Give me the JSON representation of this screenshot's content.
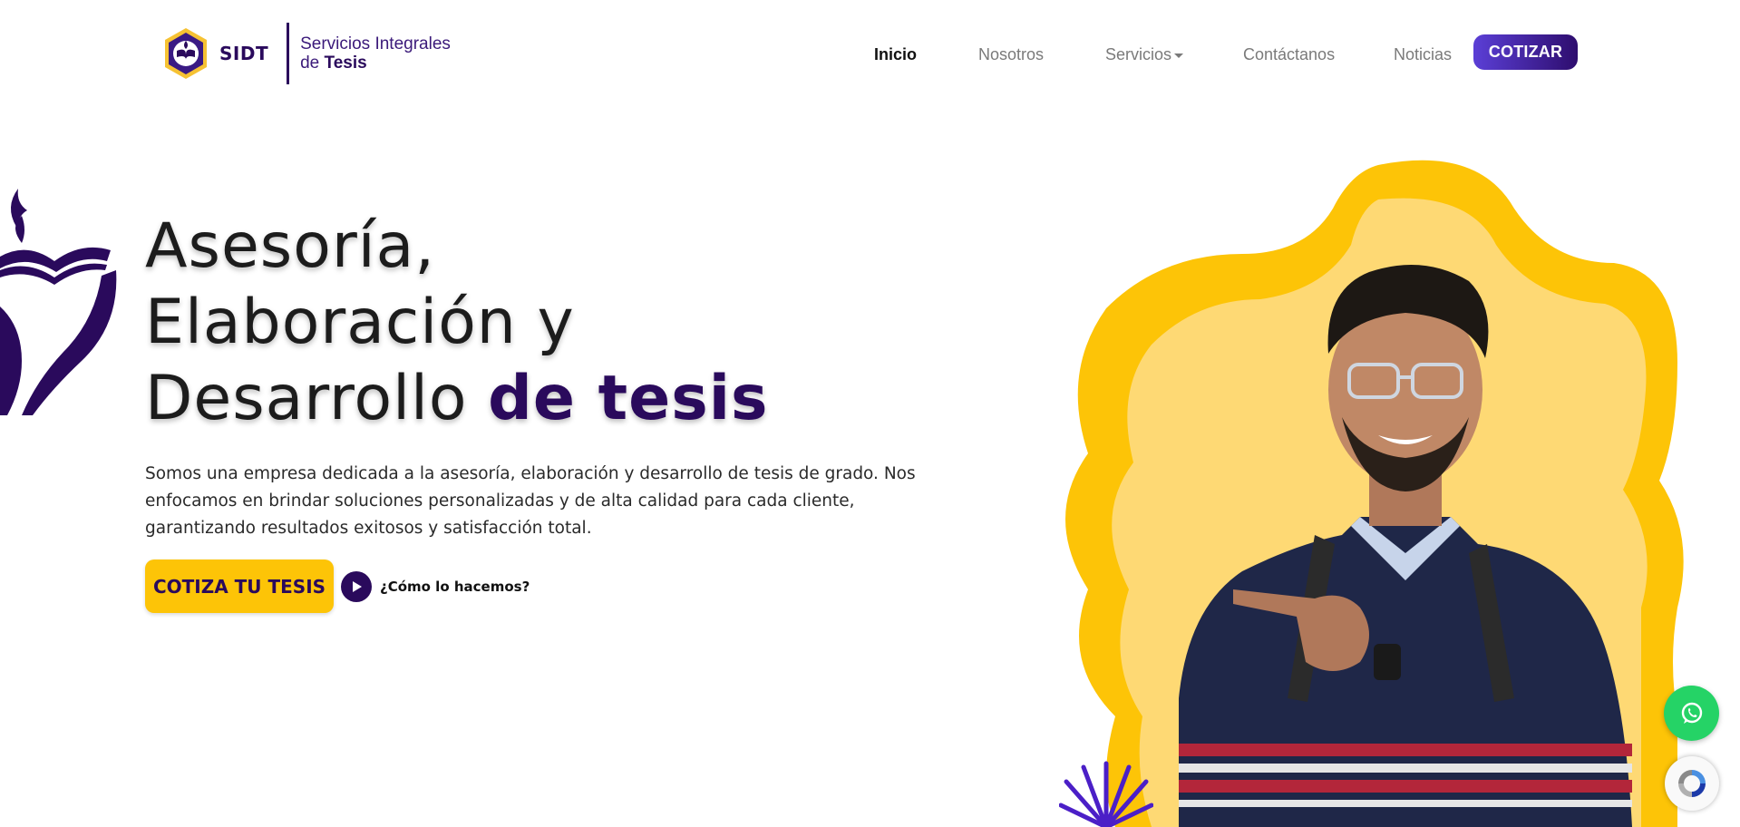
{
  "brand": {
    "acronym": "SIDT",
    "name_line1": "Servicios Integrales",
    "name_line2_prefix": "de ",
    "name_line2_bold": "Tesis",
    "logo_icon": "shield-book-logo-icon"
  },
  "nav": {
    "items": [
      {
        "label": "Inicio",
        "active": true
      },
      {
        "label": "Nosotros",
        "active": false
      },
      {
        "label": "Servicios",
        "active": false,
        "has_dropdown": true
      },
      {
        "label": "Contáctanos",
        "active": false
      },
      {
        "label": "Noticias",
        "active": false
      }
    ],
    "cta_label": "COTIZAR"
  },
  "hero": {
    "title_line1": "Asesoría,",
    "title_line2": "Elaboración y",
    "title_line3_plain": "Desarrollo ",
    "title_line3_accent": "de tesis",
    "description": "Somos una empresa dedicada a la asesoría, elaboración y desarrollo de tesis de grado. Nos enfocamos en brindar soluciones personalizadas y de alta calidad para cada cliente, garantizando resultados exitosos y satisfacción total.",
    "primary_button": "COTIZA TU TESIS",
    "secondary_link": "¿Cómo lo hacemos?"
  },
  "floating": {
    "whatsapp_icon": "whatsapp-icon",
    "recaptcha_icon": "recaptcha-icon"
  },
  "colors": {
    "brand_purple": "#2a0a5c",
    "accent_yellow": "#fdc407",
    "cta_gradient_start": "#5b3fd6",
    "whatsapp_green": "#25d366"
  }
}
